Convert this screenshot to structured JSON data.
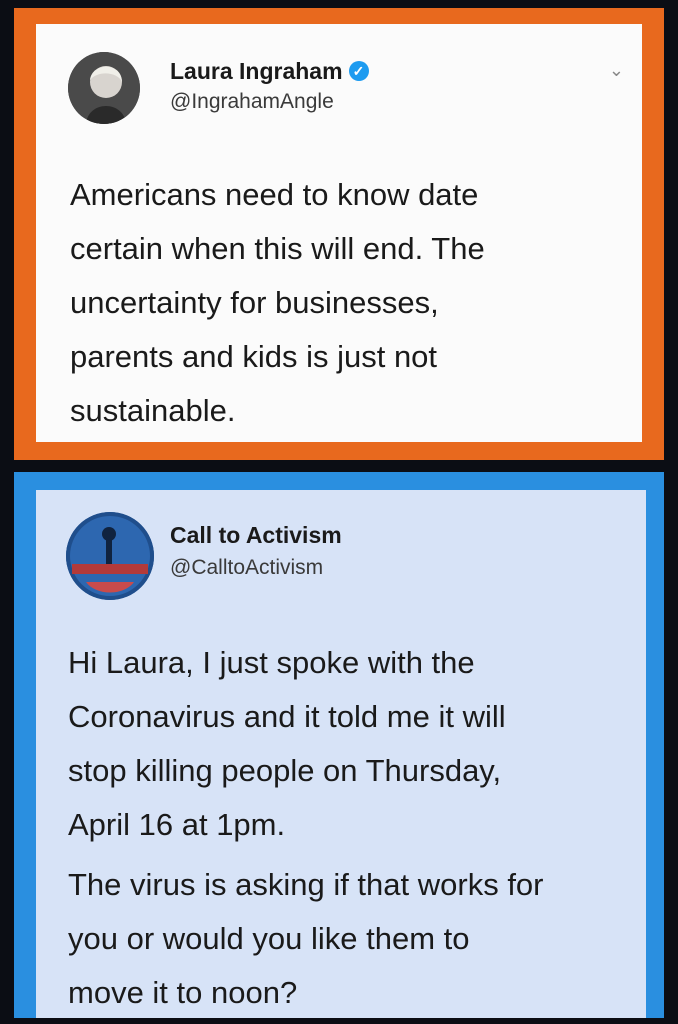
{
  "tweet1": {
    "name": "Laura Ingraham",
    "handle": "@IngrahamAngle",
    "text_lines": [
      "Americans need to know date",
      "certain when this will end.  The",
      "uncertainty for businesses,",
      "parents and kids is just not",
      "sustainable."
    ],
    "verified_icon": "verified-badge-icon",
    "menu_icon": "chevron-down-icon",
    "border_color": "#e8691e"
  },
  "tweet2": {
    "name": "Call to Activism",
    "handle": "@CalltoActivism",
    "text_lines": [
      "Hi Laura, I just spoke with the",
      "Coronavirus and it told me it will",
      "stop killing people on Thursday,",
      "April 16 at 1pm."
    ],
    "text_lines_2": [
      "The virus is asking if that works for",
      "you or would you like them to",
      "move it to noon?"
    ],
    "border_color": "#2a8fe0"
  }
}
